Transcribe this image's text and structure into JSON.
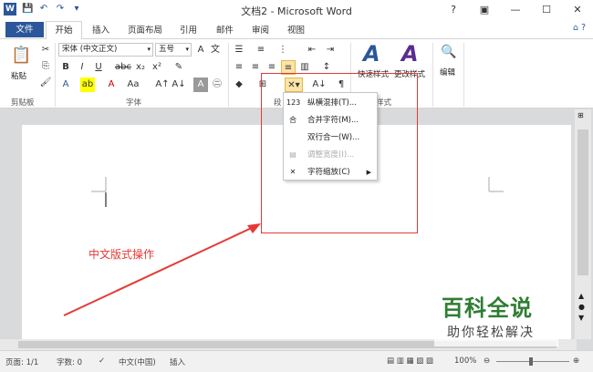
{
  "window": {
    "title": "文档2 - Microsoft Word"
  },
  "qat": {
    "save": "💾",
    "undo": "↶",
    "redo": "↷"
  },
  "tabs": [
    "文件",
    "开始",
    "插入",
    "页面布局",
    "引用",
    "邮件",
    "审阅",
    "视图"
  ],
  "ribbon": {
    "clipboard_label": "剪贴板",
    "paste_label": "粘贴",
    "font_label": "字体",
    "paragraph_label": "段",
    "styles_label": "样式",
    "font_name": "宋体 (中文正文)",
    "font_size": "五号",
    "quick_styles": "快速样式",
    "change_styles": "更改样式",
    "edit_label": "编辑"
  },
  "menu": {
    "items": [
      {
        "icon": "123",
        "label": "纵横混排(T)...",
        "disabled": false
      },
      {
        "icon": "合",
        "label": "合并字符(M)...",
        "disabled": false
      },
      {
        "icon": "",
        "label": "双行合一(W)...",
        "disabled": false
      },
      {
        "icon": "▤",
        "label": "调整宽度(I)...",
        "disabled": true
      },
      {
        "icon": "✕",
        "label": "字符缩放(C)",
        "disabled": false
      }
    ]
  },
  "annotation": {
    "text": "中文版式操作",
    "color": "#e53935"
  },
  "statusbar": {
    "page": "页面: 1/1",
    "words": "字数: 0",
    "lang": "中文(中国)",
    "mode": "插入",
    "zoom": "100%"
  },
  "watermark": {
    "main": "百科全说",
    "sub": "助你轻松解决"
  },
  "colors": {
    "brand": "#2b579a",
    "annotation": "#e53935",
    "watermark": "#2e7d32"
  }
}
